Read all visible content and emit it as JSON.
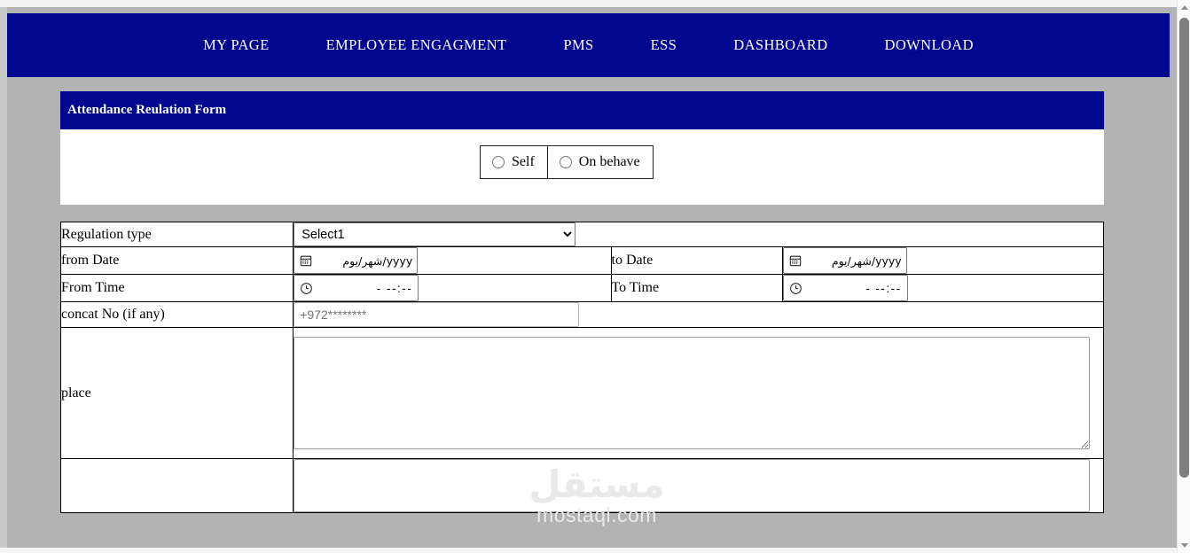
{
  "nav": {
    "items": [
      {
        "label": "MY PAGE",
        "name": "nav-my-page"
      },
      {
        "label": "EMPLOYEE ENGAGMENT",
        "name": "nav-employee-engagment"
      },
      {
        "label": "PMS",
        "name": "nav-pms"
      },
      {
        "label": "ESS",
        "name": "nav-ess"
      },
      {
        "label": "DASHBOARD",
        "name": "nav-dashboard"
      },
      {
        "label": "DOWNLOAD",
        "name": "nav-download"
      }
    ]
  },
  "card": {
    "title": "Attendance Reulation Form",
    "radios": [
      {
        "label": "Self",
        "selected": false
      },
      {
        "label": "On behave",
        "selected": false
      }
    ]
  },
  "form": {
    "regulation_type": {
      "label": "Regulation type",
      "selected": "Select1",
      "options": [
        "Select1"
      ]
    },
    "from_date": {
      "label": "from Date",
      "placeholder": "yyyy/شهر/يوم",
      "value": ""
    },
    "to_date": {
      "label": "to Date",
      "placeholder": "yyyy/شهر/يوم",
      "value": ""
    },
    "from_time": {
      "label": "From Time",
      "placeholder": "- --:--",
      "value": ""
    },
    "to_time": {
      "label": "To Time",
      "placeholder": "- --:--",
      "value": ""
    },
    "contact_no": {
      "label": "concat No (if any)",
      "placeholder": "+972********",
      "value": ""
    },
    "place": {
      "label": "place",
      "placeholder": "",
      "value": ""
    },
    "next_row": {
      "label": "",
      "value": ""
    }
  },
  "watermark": {
    "arabic": "مستقل",
    "latin": "mostaql.com"
  },
  "colors": {
    "nav_background": "#00068e",
    "page_background": "#b3b3b3",
    "panel_background": "#ffffff",
    "nav_text": "#ffffff",
    "border": "#000000"
  }
}
